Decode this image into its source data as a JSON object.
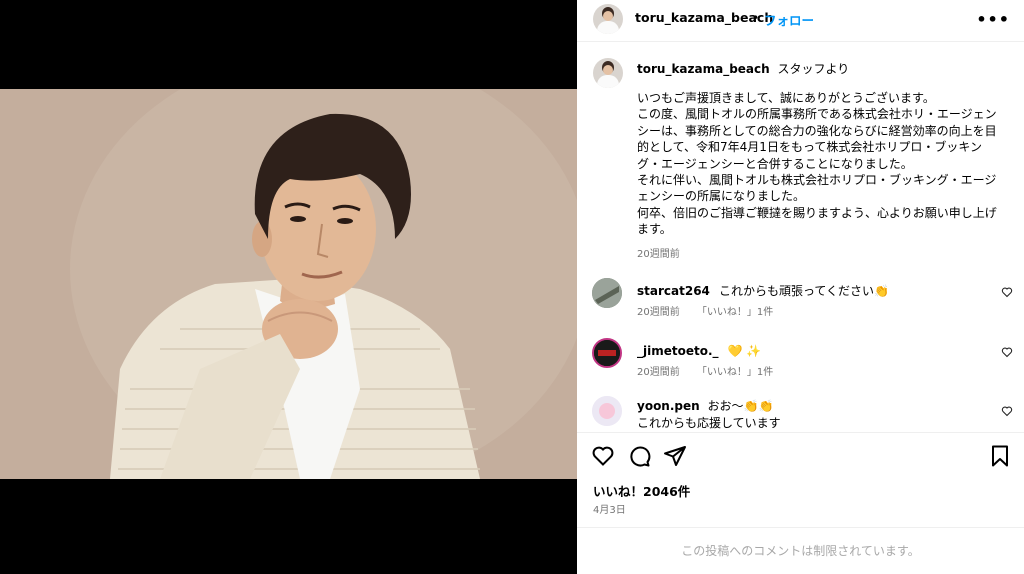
{
  "header": {
    "username": "toru_kazama_beach",
    "separator": "•",
    "follow_label": "フォロー",
    "more_icon": "more-horizontal-icon"
  },
  "caption": {
    "username": "toru_kazama_beach",
    "subtitle": "スタッフより",
    "lines": [
      "いつもご声援頂きまして、誠にありがとうございます。",
      "この度、風間トオルの所属事務所である株式会社ホリ・エージェンシーは、事務所としての総合力の強化ならびに経営効率の向上を目的として、令和7年4月1日をもって株式会社ホリプロ・ブッキング・エージェンシーと合併することになりました。",
      "それに伴い、風間トオルも株式会社ホリプロ・ブッキング・エージェンシーの所属になりました。",
      "何卒、倍旧のご指導ご鞭撻を賜りますよう、心よりお願い申し上げます。"
    ],
    "time": "20週間前"
  },
  "comments": [
    {
      "username": "starcat264",
      "text": "これからも頑張ってください👏",
      "time": "20週間前",
      "likes": "「いいね！」1件"
    },
    {
      "username": "_jimetoeto._",
      "text": "💛 ✨",
      "time": "20週間前",
      "likes": "「いいね！」1件"
    },
    {
      "username": "yoon.pen",
      "text": "おお〜👏👏",
      "text2": "これからも応援しています"
    }
  ],
  "actions": {
    "like_icon": "heart-icon",
    "comment_icon": "comment-icon",
    "share_icon": "send-icon",
    "save_icon": "bookmark-icon",
    "likes_label": "いいね！2046件",
    "date": "4月3日"
  },
  "footer": {
    "notice": "この投稿へのコメントは制限されています。"
  },
  "colors": {
    "accent": "#0095f6",
    "muted": "#737373",
    "border": "#efefef"
  }
}
